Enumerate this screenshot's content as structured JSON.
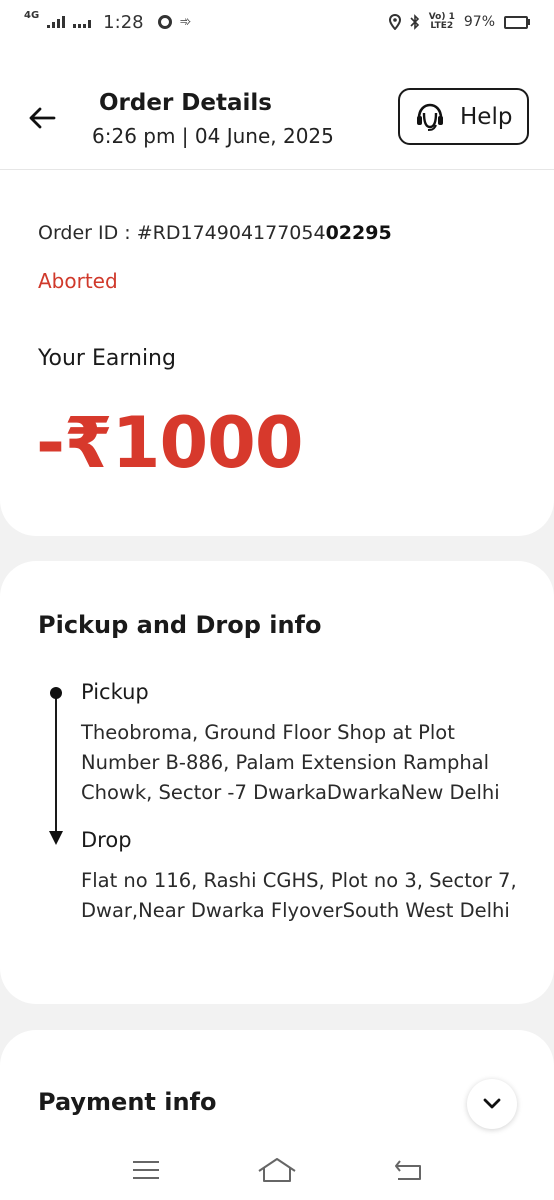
{
  "status_bar": {
    "network": "4G",
    "time": "1:28",
    "volte": "Vo) 1",
    "lte": "LTE2",
    "battery": "97%",
    "battery_level": 0.97
  },
  "header": {
    "title": "Order Details",
    "subtitle": "6:26 pm | 04 June, 2025",
    "help_label": "Help"
  },
  "order": {
    "id_prefix": "Order ID : #RD174904177054",
    "id_suffix": "02295",
    "status": "Aborted",
    "earning_label": "Your Earning",
    "earning_value": "-₹1000"
  },
  "route": {
    "title": "Pickup and Drop info",
    "pickup_label": "Pickup",
    "pickup_address": "Theobroma, Ground Floor Shop at Plot Number B-886, Palam Extension Ramphal Chowk, Sector -7 DwarkaDwarkaNew Delhi",
    "drop_label": "Drop",
    "drop_address": "Flat no 116, Rashi CGHS, Plot no 3, Sector 7, Dwar,Near Dwarka FlyoverSouth West Delhi"
  },
  "payment": {
    "title": "Payment info"
  },
  "colors": {
    "accent_red": "#d7392c",
    "text_dark": "#1a1a1a",
    "background": "#f2f2f2"
  },
  "icons": {
    "back": "arrow-left-icon",
    "help": "headset-icon",
    "expand": "chevron-down-icon",
    "nav_menu": "menu-icon",
    "nav_home": "home-icon",
    "nav_back": "back-icon"
  }
}
